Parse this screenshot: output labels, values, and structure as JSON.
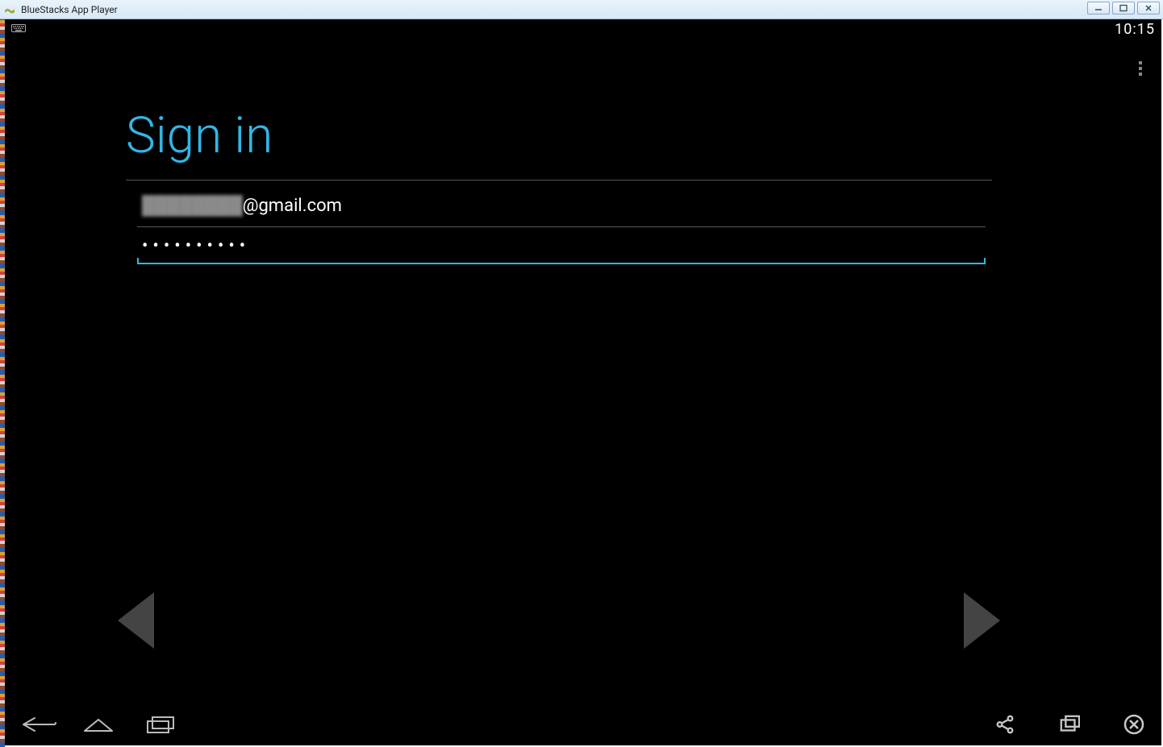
{
  "window": {
    "title": "BlueStacks App Player"
  },
  "status_bar": {
    "time": "10:15"
  },
  "signin": {
    "title": "Sign in",
    "email_local": "████████",
    "email_domain": "@gmail.com",
    "password_display": "••••••••••"
  }
}
